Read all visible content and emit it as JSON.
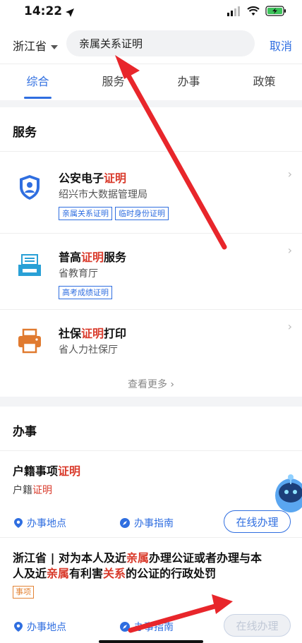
{
  "status": {
    "time": "14:22"
  },
  "search": {
    "province": "浙江省",
    "query": "亲属关系证明",
    "cancel": "取消"
  },
  "tabs": [
    "综合",
    "服务",
    "办事",
    "政策"
  ],
  "services": {
    "title": "服务",
    "items": [
      {
        "title_a": "公安电子",
        "title_hl": "证明",
        "title_b": "",
        "sub": "绍兴市大数据管理局",
        "tags": [
          "亲属关系证明",
          "临时身份证明"
        ],
        "icon": "shield-person-icon"
      },
      {
        "title_a": "普高",
        "title_hl": "证明",
        "title_b": "服务",
        "sub": "省教育厅",
        "tags": [
          "高考成绩证明"
        ],
        "icon": "printer-tray-icon"
      },
      {
        "title_a": "社保",
        "title_hl": "证明",
        "title_b": "打印",
        "sub": "省人力社保厅",
        "tags": [],
        "icon": "printer-icon"
      }
    ],
    "more": "查看更多"
  },
  "affairs": {
    "title": "办事",
    "items": [
      {
        "title_parts": [
          "户籍事项",
          "证明"
        ],
        "sub_parts": [
          "户籍",
          "证明"
        ],
        "location": "办事地点",
        "guide": "办事指南",
        "action": "在线办理"
      },
      {
        "title_line1_parts": [
          "浙江省 | 对为本人及近",
          "亲属",
          "办理公证或者办理与本"
        ],
        "title_line2_parts": [
          "人及近",
          "亲属",
          "有利害",
          "关系",
          "的公证的行政处罚"
        ],
        "badge": "事项",
        "location": "办事地点",
        "guide": "办事指南",
        "action": "在线办理"
      }
    ]
  },
  "colors": {
    "accent": "#2f6ee0",
    "highlight": "#d93a2b",
    "badge": "#e38335",
    "annotation_arrow": "#e8262b"
  }
}
